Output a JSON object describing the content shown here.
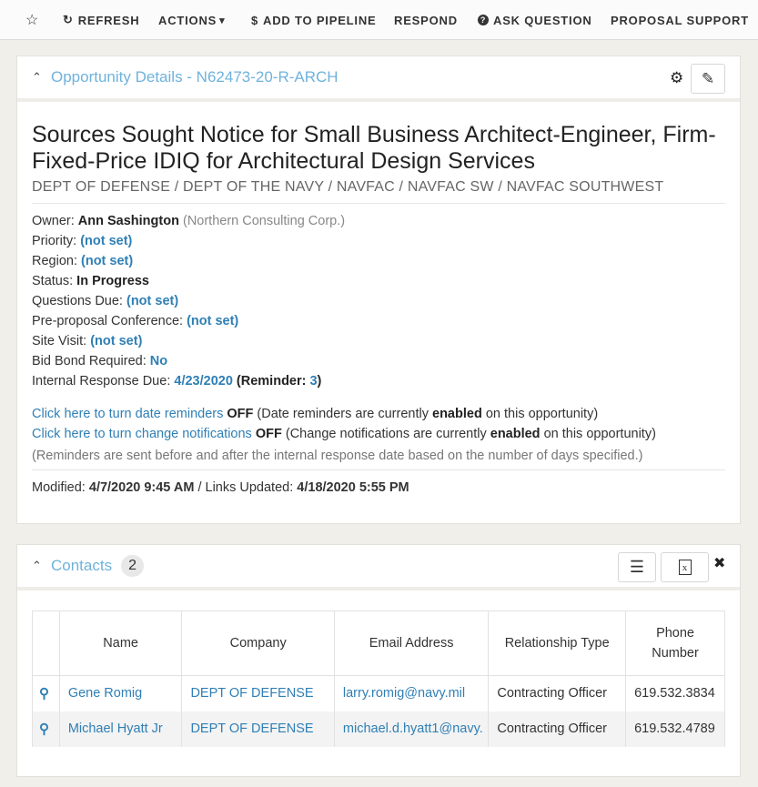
{
  "toolbar": {
    "refresh": "REFRESH",
    "actions": "ACTIONS",
    "add_to_pipeline": "ADD TO PIPELINE",
    "respond": "RESPOND",
    "ask_question": "ASK QUESTION",
    "proposal_support": "PROPOSAL SUPPORT"
  },
  "details": {
    "header": "Opportunity Details - N62473-20-R-ARCH",
    "title": "Sources Sought Notice for Small Business Architect-Engineer, Firm-Fixed-Price IDIQ for Architectural Design Services",
    "agency": "DEPT OF DEFENSE / DEPT OF THE NAVY / NAVFAC / NAVFAC SW / NAVFAC SOUTHWEST",
    "owner_label": "Owner:",
    "owner_name": "Ann Sashington",
    "owner_org": "(Northern Consulting Corp.)",
    "priority_label": "Priority:",
    "priority": "(not set)",
    "region_label": "Region:",
    "region": "(not set)",
    "status_label": "Status:",
    "status": "In Progress",
    "questions_label": "Questions Due:",
    "questions": "(not set)",
    "preproposal_label": "Pre-proposal Conference:",
    "preproposal": "(not set)",
    "site_visit_label": "Site Visit:",
    "site_visit": "(not set)",
    "bid_bond_label": "Bid Bond Required:",
    "bid_bond": "No",
    "internal_due_label": "Internal Response Due:",
    "internal_due": "4/23/2020",
    "reminder_label": "(Reminder:",
    "reminder_value": "3",
    "reminder_close": ")",
    "date_reminders_link": "Click here to turn date reminders",
    "date_reminders_off": "OFF",
    "date_reminders_note_a": "(Date reminders are currently",
    "date_reminders_enabled": "enabled",
    "date_reminders_note_b": "on this opportunity)",
    "change_notif_link": "Click here to turn change notifications",
    "change_notif_off": "OFF",
    "change_notif_note_a": "(Change notifications are currently",
    "change_notif_enabled": "enabled",
    "change_notif_note_b": "on this opportunity)",
    "reminder_note": "(Reminders are sent before and after the internal response date based on the number of days specified.)",
    "modified_label": "Modified:",
    "modified": "4/7/2020 9:45 AM",
    "links_label": "/ Links Updated:",
    "links_updated": "4/18/2020 5:55 PM"
  },
  "contacts": {
    "header": "Contacts",
    "count": "2",
    "columns": [
      "Name",
      "Company",
      "Email Address",
      "Relationship Type",
      "Phone Number"
    ],
    "rows": [
      {
        "name": "Gene Romig",
        "company": "DEPT OF DEFENSE",
        "email": "larry.romig@navy.mil",
        "relationship": "Contracting Officer",
        "phone": "619.532.3834"
      },
      {
        "name": "Michael Hyatt Jr",
        "company": "DEPT OF DEFENSE",
        "email": "michael.d.hyatt1@navy.",
        "relationship": "Contracting Officer",
        "phone": "619.532.4789"
      }
    ]
  },
  "icons": {
    "star": "☆",
    "refresh": "↻",
    "caret": "▾",
    "dollar": "$",
    "question": "?",
    "collapse": "⌃",
    "gear": "⚙",
    "pencil": "✎",
    "list": "☰",
    "excel": "x",
    "close": "✖",
    "search": "⚲"
  }
}
